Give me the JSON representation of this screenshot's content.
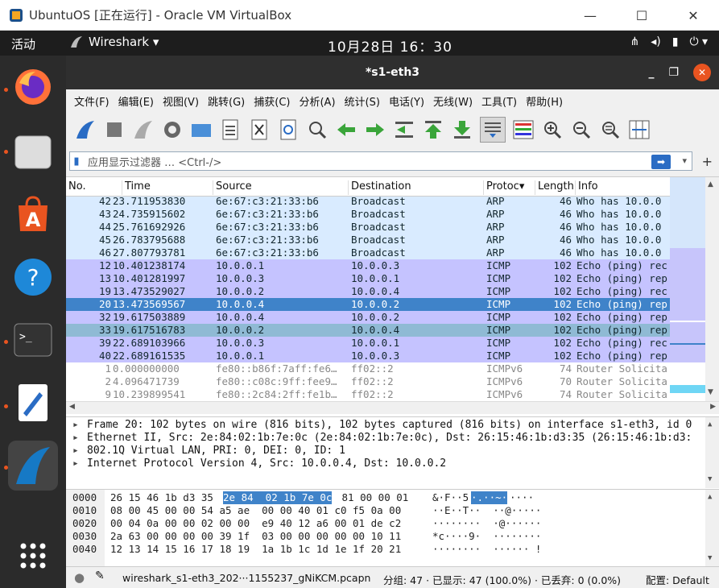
{
  "host": {
    "title": "UbuntuOS [正在运行] - Oracle VM VirtualBox",
    "min": "—",
    "max": "☐",
    "close": "✕"
  },
  "topbar": {
    "activities": "活动",
    "app": "Wireshark ▾",
    "clock": "10月28日  16：30",
    "tray": [
      "⋔",
      "◂)",
      "▮",
      "⏻ ▾"
    ]
  },
  "window": {
    "title": "*s1-eth3",
    "min": "_",
    "restore": "❐",
    "close": "✕"
  },
  "menu": [
    "文件(F)",
    "编辑(E)",
    "视图(V)",
    "跳转(G)",
    "捕获(C)",
    "分析(A)",
    "统计(S)",
    "电话(Y)",
    "无线(W)",
    "工具(T)",
    "帮助(H)"
  ],
  "filter": {
    "placeholder": "应用显示过滤器 … <Ctrl-/>",
    "dropdown": "▾",
    "add": "+"
  },
  "columns": [
    "No.",
    "Time",
    "Source",
    "Destination",
    "Protoc▾",
    "Length",
    "Info"
  ],
  "packets": [
    {
      "no": "42",
      "time": "23.711953830",
      "src": "6e:67:c3:21:33:b6",
      "dst": "Broadcast",
      "proto": "ARP",
      "len": "46",
      "info": "Who has 10.0.0",
      "cls": "arp"
    },
    {
      "no": "43",
      "time": "24.735915602",
      "src": "6e:67:c3:21:33:b6",
      "dst": "Broadcast",
      "proto": "ARP",
      "len": "46",
      "info": "Who has 10.0.0",
      "cls": "arp"
    },
    {
      "no": "44",
      "time": "25.761692926",
      "src": "6e:67:c3:21:33:b6",
      "dst": "Broadcast",
      "proto": "ARP",
      "len": "46",
      "info": "Who has 10.0.0",
      "cls": "arp"
    },
    {
      "no": "45",
      "time": "26.783795688",
      "src": "6e:67:c3:21:33:b6",
      "dst": "Broadcast",
      "proto": "ARP",
      "len": "46",
      "info": "Who has 10.0.0",
      "cls": "arp"
    },
    {
      "no": "46",
      "time": "27.807793781",
      "src": "6e:67:c3:21:33:b6",
      "dst": "Broadcast",
      "proto": "ARP",
      "len": "46",
      "info": "Who has 10.0.0",
      "cls": "arp"
    },
    {
      "no": "12",
      "time": "10.401238174",
      "src": "10.0.0.1",
      "dst": "10.0.0.3",
      "proto": "ICMP",
      "len": "102",
      "info": "Echo (ping) rec",
      "cls": "icmp"
    },
    {
      "no": "13",
      "time": "10.401281997",
      "src": "10.0.0.3",
      "dst": "10.0.0.1",
      "proto": "ICMP",
      "len": "102",
      "info": "Echo (ping) rep",
      "cls": "icmp"
    },
    {
      "no": "19",
      "time": "13.473529027",
      "src": "10.0.0.2",
      "dst": "10.0.0.4",
      "proto": "ICMP",
      "len": "102",
      "info": "Echo (ping) rec",
      "cls": "icmp"
    },
    {
      "no": "20",
      "time": "13.473569567",
      "src": "10.0.0.4",
      "dst": "10.0.0.2",
      "proto": "ICMP",
      "len": "102",
      "info": "Echo (ping) rep",
      "cls": "sel"
    },
    {
      "no": "32",
      "time": "19.617503889",
      "src": "10.0.0.4",
      "dst": "10.0.0.2",
      "proto": "ICMP",
      "len": "102",
      "info": "Echo (ping) rep",
      "cls": "icmp"
    },
    {
      "no": "33",
      "time": "19.617516783",
      "src": "10.0.0.2",
      "dst": "10.0.0.4",
      "proto": "ICMP",
      "len": "102",
      "info": "Echo (ping) rep",
      "cls": "rel"
    },
    {
      "no": "39",
      "time": "22.689103966",
      "src": "10.0.0.3",
      "dst": "10.0.0.1",
      "proto": "ICMP",
      "len": "102",
      "info": "Echo (ping) rec",
      "cls": "icmp"
    },
    {
      "no": "40",
      "time": "22.689161535",
      "src": "10.0.0.1",
      "dst": "10.0.0.3",
      "proto": "ICMP",
      "len": "102",
      "info": "Echo (ping) rep",
      "cls": "icmp"
    },
    {
      "no": "1",
      "time": "0.000000000",
      "src": "fe80::b86f:7aff:fe6…",
      "dst": "ff02::2",
      "proto": "ICMPv6",
      "len": "74",
      "info": "Router Solicita",
      "cls": "v6"
    },
    {
      "no": "2",
      "time": "4.096471739",
      "src": "fe80::c08c:9ff:fee9…",
      "dst": "ff02::2",
      "proto": "ICMPv6",
      "len": "70",
      "info": "Router Solicita",
      "cls": "v6"
    },
    {
      "no": "9",
      "time": "10.239899541",
      "src": "fe80::2c84:2ff:fe1b…",
      "dst": "ff02::2",
      "proto": "ICMPv6",
      "len": "74",
      "info": "Router Solicita",
      "cls": "v6"
    }
  ],
  "details": [
    "Frame 20: 102 bytes on wire (816 bits), 102 bytes captured (816 bits) on interface s1-eth3, id 0",
    "Ethernet II, Src: 2e:84:02:1b:7e:0c (2e:84:02:1b:7e:0c), Dst: 26:15:46:1b:d3:35 (26:15:46:1b:d3:",
    "802.1Q Virtual LAN, PRI: 0, DEI: 0, ID: 1",
    "Internet Protocol Version 4, Src: 10.0.0.4, Dst: 10.0.0.2"
  ],
  "hex": [
    {
      "off": "0000",
      "a": "26 15 46 1b d3 35 ",
      "h": "2e 84  02 1b 7e 0c",
      "b": " 81 00 00 01",
      "asc1": "&·F··5",
      "asch": "·.··~·",
      "asc2": "····"
    },
    {
      "off": "0010",
      "a": "08 00 45 00 00 54 a5 ae  00 00 40 01 c0 f5 0a 00",
      "h": "",
      "b": "",
      "asc1": "··E··T··  ··@·····",
      "asch": "",
      "asc2": ""
    },
    {
      "off": "0020",
      "a": "00 04 0a 00 00 02 00 00  e9 40 12 a6 00 01 de c2",
      "h": "",
      "b": "",
      "asc1": "········  ·@······",
      "asch": "",
      "asc2": ""
    },
    {
      "off": "0030",
      "a": "2a 63 00 00 00 00 39 1f  03 00 00 00 00 00 10 11",
      "h": "",
      "b": "",
      "asc1": "*c····9·  ········",
      "asch": "",
      "asc2": ""
    },
    {
      "off": "0040",
      "a": "12 13 14 15 16 17 18 19  1a 1b 1c 1d 1e 1f 20 21",
      "h": "",
      "b": "",
      "asc1": "········  ······ !",
      "asch": "",
      "asc2": ""
    }
  ],
  "status": {
    "file": "wireshark_s1-eth3_202···1155237_gNiKCM.pcapn",
    "packets": "分组: 47 · 已显示: 47 (100.0%) · 已丢弃: 0 (0.0%)",
    "profile": "配置: Default"
  },
  "colors": {
    "accent": "#3f83c9",
    "ubuntu": "#e95420"
  }
}
